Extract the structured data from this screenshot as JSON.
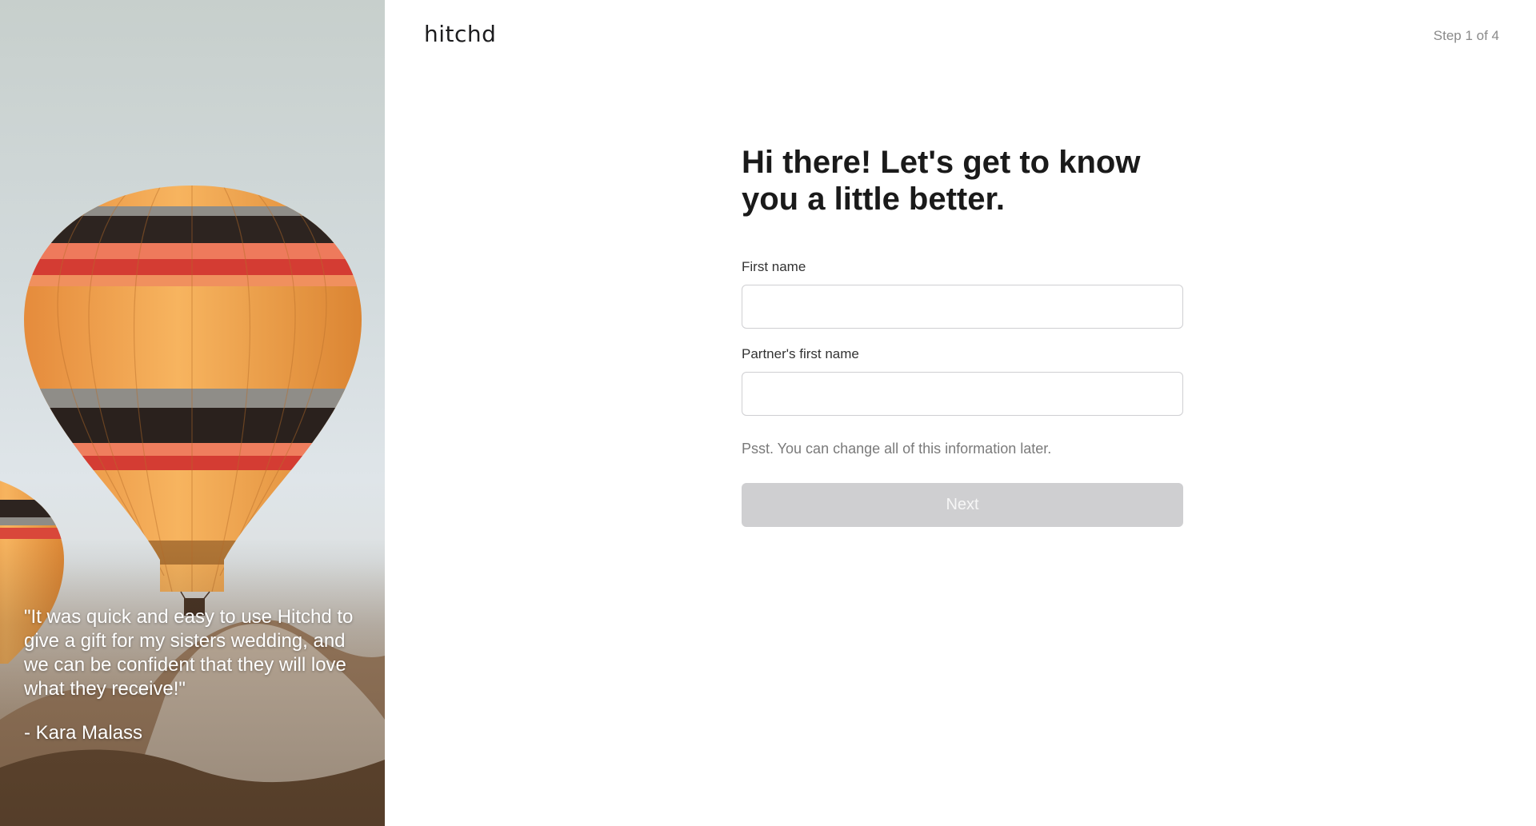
{
  "brand": {
    "logo_text": "hitchd"
  },
  "header": {
    "step": "Step 1 of 4"
  },
  "form": {
    "headline": "Hi there! Let's get to know you a little better.",
    "first_name_label": "First name",
    "first_name_value": "",
    "partner_label": "Partner's first name",
    "partner_value": "",
    "hint": "Psst. You can change all of this information later.",
    "next_label": "Next"
  },
  "testimonial": {
    "quote": "\"It was quick and easy to use Hitchd to give a gift for my sisters wedding, and we can be confident that they will love what they receive!\"",
    "author": "- Kara Malass"
  },
  "colors": {
    "button_disabled": "#cfcfd1",
    "balloon_orange": "#f2a14a",
    "balloon_dark": "#2d2420",
    "balloon_red": "#d9473a"
  }
}
